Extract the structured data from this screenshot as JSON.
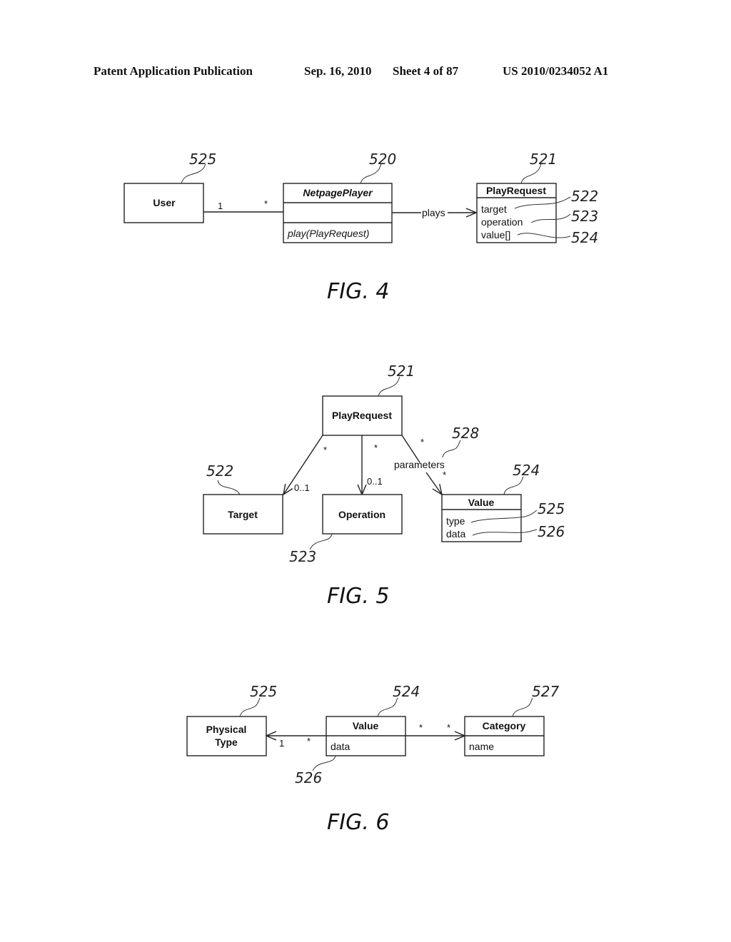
{
  "header": {
    "left": "Patent Application Publication",
    "date": "Sep. 16, 2010",
    "sheet": "Sheet 4 of 87",
    "number": "US 2010/0234052 A1"
  },
  "fig4": {
    "caption": "FIG. 4",
    "user": {
      "name": "User",
      "ref": "525"
    },
    "player": {
      "name": "NetpagePlayer",
      "ref": "520",
      "method": "play(PlayRequest)"
    },
    "request": {
      "name": "PlayRequest",
      "ref": "521",
      "attributes": [
        {
          "label": "target",
          "ref": "522"
        },
        {
          "label": "operation",
          "ref": "523"
        },
        {
          "label": "value[]",
          "ref": "524"
        }
      ]
    },
    "assoc_user_player": {
      "left_mult": "1",
      "right_mult": "*"
    },
    "assoc_plays": {
      "label": "plays"
    }
  },
  "fig5": {
    "caption": "FIG. 5",
    "request": {
      "name": "PlayRequest",
      "ref": "521"
    },
    "target": {
      "name": "Target",
      "ref": "522",
      "mult_src": "*",
      "mult_dst": "0..1"
    },
    "operation": {
      "name": "Operation",
      "ref": "523",
      "mult_src": "*",
      "mult_dst": "0..1"
    },
    "value": {
      "name": "Value",
      "ref": "524",
      "mult_src": "*",
      "mult_dst": "*",
      "role": "parameters",
      "role_ref": "528",
      "attributes": [
        {
          "label": "type",
          "ref": "525"
        },
        {
          "label": "data",
          "ref": "526"
        }
      ]
    }
  },
  "fig6": {
    "caption": "FIG. 6",
    "physical_type": {
      "name_line1": "Physical",
      "name_line2": "Type",
      "ref": "525"
    },
    "value": {
      "name": "Value",
      "ref": "524",
      "attribute": "data",
      "attr_ref": "526"
    },
    "category": {
      "name": "Category",
      "ref": "527",
      "attribute": "name"
    },
    "assoc_value_type": {
      "type_mult": "1",
      "value_mult": "*"
    },
    "assoc_value_category": {
      "value_mult": "*",
      "category_mult": "*"
    }
  }
}
